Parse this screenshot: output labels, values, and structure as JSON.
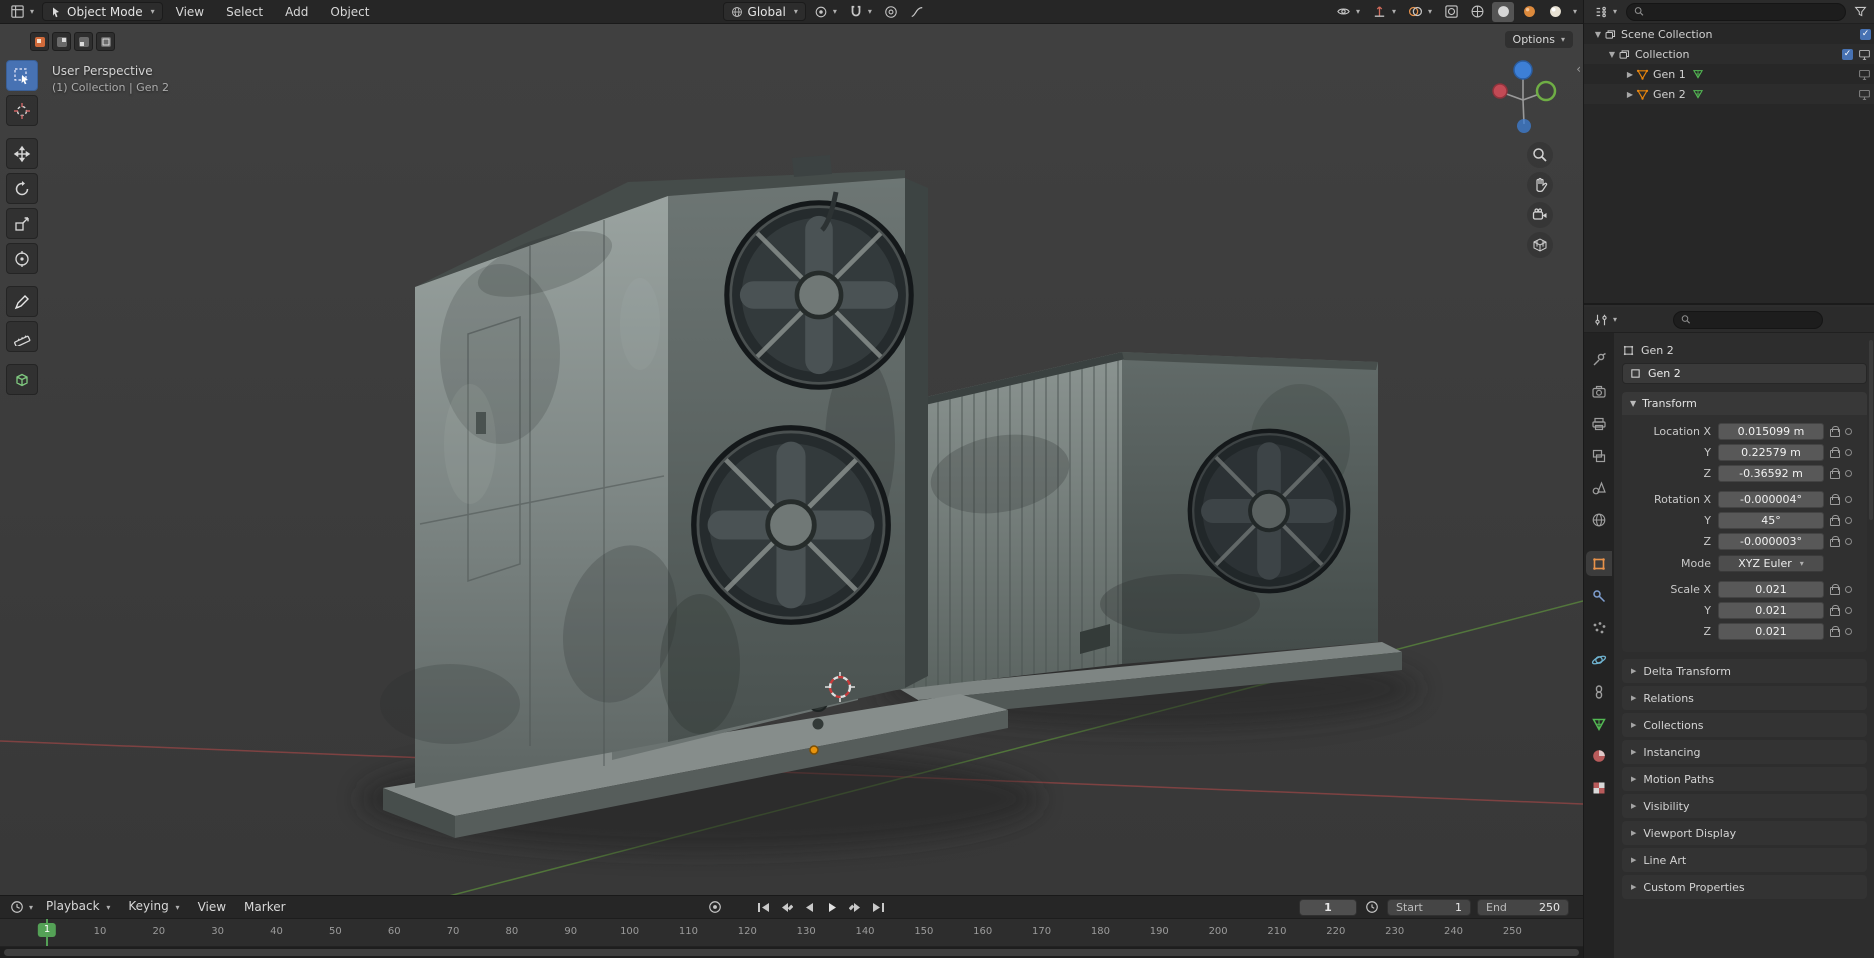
{
  "colors": {
    "accent_orange": "#e8850d",
    "accent_blue": "#4772b3",
    "axis_red": "#b84a4a",
    "axis_green": "#67a83d",
    "playhead_green": "#54a156"
  },
  "topbar": {
    "mode_dropdown": "Object Mode",
    "menus": [
      "View",
      "Select",
      "Add",
      "Object"
    ],
    "orientation_dropdown": "Global"
  },
  "viewport": {
    "view_label": "User Perspective",
    "context_label": "(1) Collection | Gen 2",
    "options_button": "Options"
  },
  "outliner": {
    "root": "Scene Collection",
    "collection": "Collection",
    "objects": [
      "Gen 1",
      "Gen 2"
    ]
  },
  "properties": {
    "breadcrumb_object": "Gen 2",
    "name_field": "Gen 2",
    "transform_title": "Transform",
    "fields": [
      {
        "label": "Location X",
        "value": "0.015099 m"
      },
      {
        "label": "Y",
        "value": "0.22579 m"
      },
      {
        "label": "Z",
        "value": "-0.36592 m"
      },
      {
        "label": "Rotation X",
        "value": "-0.000004°"
      },
      {
        "label": "Y",
        "value": "45°"
      },
      {
        "label": "Z",
        "value": "-0.000003°"
      }
    ],
    "mode_label": "Mode",
    "mode_value": "XYZ Euler",
    "scale_fields": [
      {
        "label": "Scale X",
        "value": "0.021"
      },
      {
        "label": "Y",
        "value": "0.021"
      },
      {
        "label": "Z",
        "value": "0.021"
      }
    ],
    "sections": [
      "Delta Transform",
      "Relations",
      "Collections",
      "Instancing",
      "Motion Paths",
      "Visibility",
      "Viewport Display",
      "Line Art",
      "Custom Properties"
    ]
  },
  "timeline": {
    "playback_menu": "Playback",
    "keying_menu": "Keying",
    "view_menu": "View",
    "marker_menu": "Marker",
    "current_frame": "1",
    "start_label": "Start",
    "start_value": "1",
    "end_label": "End",
    "end_value": "250",
    "ticks": [
      10,
      20,
      30,
      40,
      50,
      60,
      70,
      80,
      90,
      100,
      110,
      120,
      130,
      140,
      150,
      160,
      170,
      180,
      190,
      200,
      210,
      220,
      230,
      240,
      250
    ]
  }
}
